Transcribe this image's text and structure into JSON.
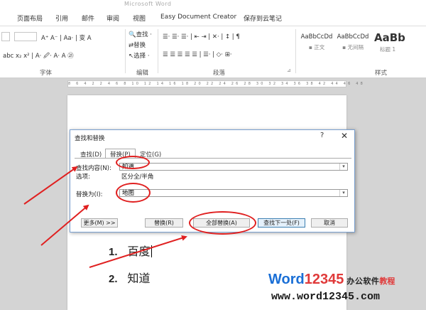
{
  "window": {
    "title": "Microsoft Word"
  },
  "ribbon_tabs": [
    "页面布局",
    "引用",
    "邮件",
    "审阅",
    "视图",
    "Easy Document Creator",
    "保存到云笔记"
  ],
  "ribbon": {
    "font_group": {
      "label": "字体",
      "row1": "A⁺ A⁻ | Aa· | 变 A",
      "row2": "abc x₂ x² | A· 🖉· A· A ㉑"
    },
    "edit_group": {
      "label": "编辑",
      "find": "查找 ·",
      "replace": "替换",
      "select": "选择 ·"
    },
    "para_group": {
      "label": "段落",
      "row1": "☰· ☰· ☰· | ⇤ ⇥ | ✕· | ↕ | ¶",
      "row2": "☰ ☰ ☰ ☰ ☰ | ☰· | ◇· ⊞·"
    },
    "styles_group": {
      "label": "样式",
      "styles": [
        {
          "sample": "AaBbCcDd",
          "name": "▪ 正文"
        },
        {
          "sample": "AaBbCcDd",
          "name": "▪ 无间隔"
        },
        {
          "sample": "AaBb",
          "name": "标题 1"
        }
      ]
    }
  },
  "ruler": {
    "marks": "8 6 4 2 2 4 6 8 10 12 14 16 18 20 22 24 26 28 30 32 34 36 38 42 44 46 48"
  },
  "document": {
    "items": [
      {
        "num": "1.",
        "text": "百度"
      },
      {
        "num": "2.",
        "text": "知道"
      }
    ]
  },
  "dialog": {
    "title": "查找和替换",
    "help": "?",
    "close": "✕",
    "tabs": [
      "查找(D)",
      "替换(P)",
      "定位(G)"
    ],
    "find_label": "查找内容(N):",
    "find_value": "知道",
    "options_label": "选项:",
    "options_value": "区分全/半角",
    "replace_label": "替换为(I):",
    "replace_value": "地图",
    "buttons": {
      "more": "更多(M) >>",
      "replace": "替换(R)",
      "replace_all": "全部替换(A)",
      "find_next": "查找下一处(F)",
      "cancel": "取消"
    }
  },
  "watermark": {
    "brand_w": "W",
    "brand_ord": "ord",
    "brand_num": "12345",
    "brand_cn": "办公软件",
    "brand_cn2": "教程",
    "url": "www.word12345.com"
  },
  "colors": {
    "annotation": "#e02020",
    "dialog_border": "#7aa0cf",
    "brand_blue": "#1a6fd6",
    "brand_red": "#e03a3a"
  }
}
